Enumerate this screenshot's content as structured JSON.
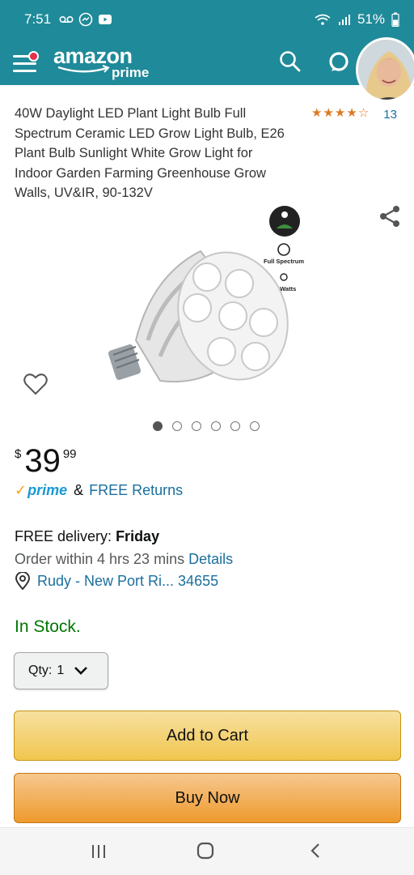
{
  "status_bar": {
    "time": "7:51",
    "battery": "51%",
    "icons": [
      "voicemail-icon",
      "messenger-icon",
      "youtube-icon",
      "wifi-icon",
      "signal-icon",
      "battery-icon"
    ]
  },
  "header": {
    "logo_text": "amazon",
    "logo_subtext": "prime",
    "icons": [
      "menu-icon",
      "search-icon",
      "alexa-icon",
      "avatar"
    ],
    "color": "#1f8a99"
  },
  "product": {
    "title": "40W Daylight LED Plant Light Bulb Full Spectrum Ceramic LED Grow Light Bulb, E26 Plant Bulb Sunlight White Grow Light for Indoor Garden Farming Greenhouse Grow Walls, UV&IR, 90-132V",
    "rating": {
      "stars": 4.5,
      "count": "13"
    },
    "image_labels": {
      "spectrum": "Full Spectrum",
      "watts": "40 Watts"
    },
    "carousel": {
      "total": 6,
      "active": 1
    },
    "price": {
      "symbol": "$",
      "whole": "39",
      "fraction": "99"
    },
    "prime_text": "prime",
    "amp": "&",
    "free_returns": "FREE Returns"
  },
  "delivery": {
    "label": "FREE delivery:",
    "day": "Friday",
    "order_within": "Order within 4 hrs 23 mins",
    "details_link": "Details",
    "location": "Rudy - New Port Ri... 34655"
  },
  "stock": {
    "text": "In Stock.",
    "color": "#007600"
  },
  "quantity": {
    "label": "Qty:",
    "value": "1"
  },
  "buttons": {
    "add_to_cart": "Add to Cart",
    "buy_now": "Buy Now"
  },
  "nav": {
    "icons": [
      "recent-apps-icon",
      "home-icon",
      "back-icon"
    ]
  }
}
